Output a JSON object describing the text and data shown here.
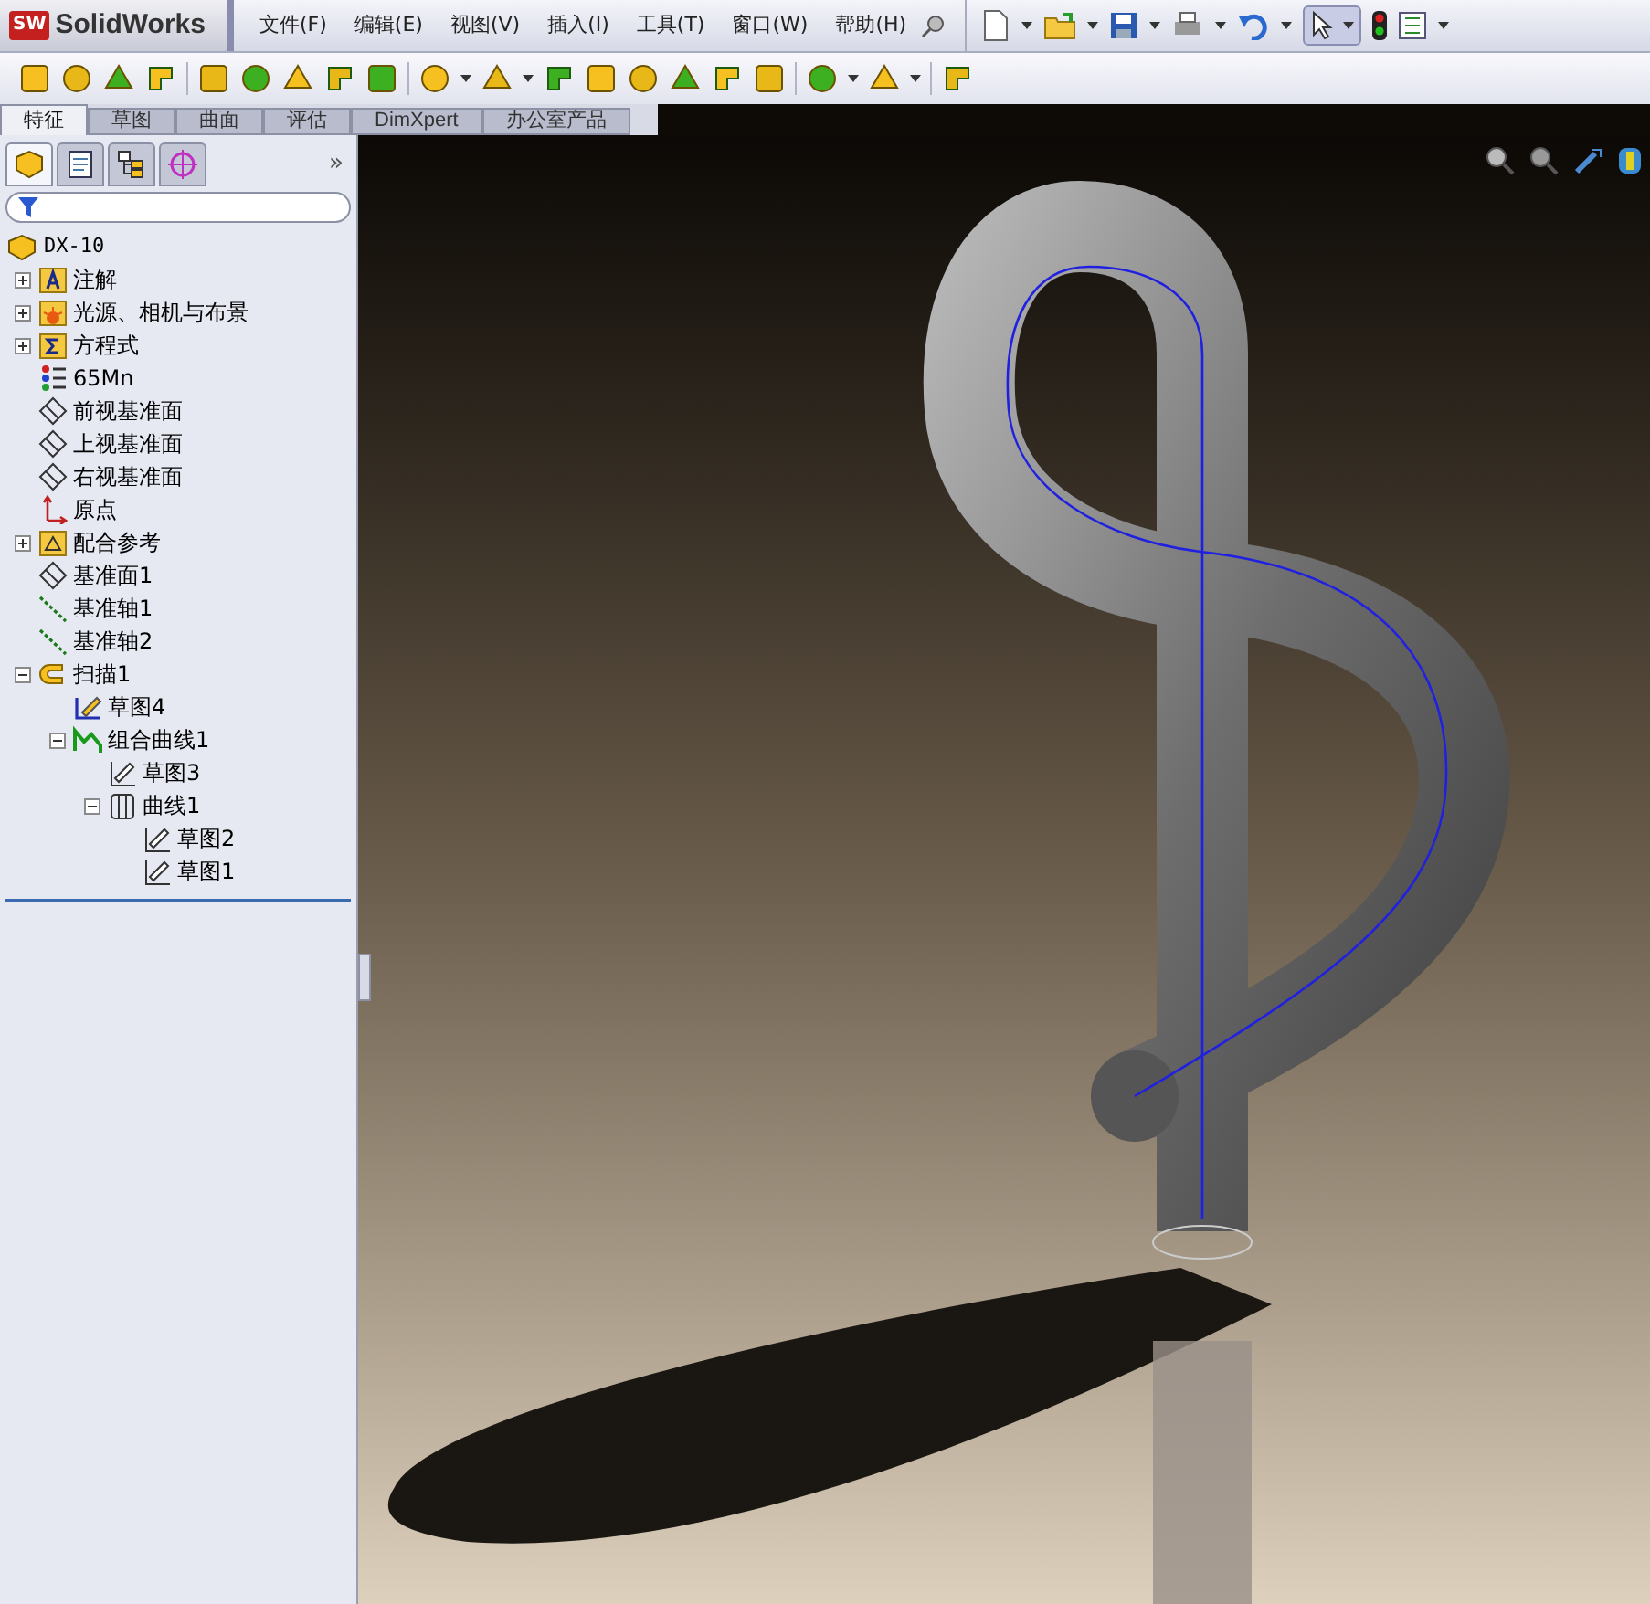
{
  "app": {
    "logo_badge": "SW",
    "logo_text": "SolidWorks"
  },
  "menu": [
    "文件(F)",
    "编辑(E)",
    "视图(V)",
    "插入(I)",
    "工具(T)",
    "窗口(W)",
    "帮助(H)"
  ],
  "tabs": [
    {
      "label": "特征",
      "selected": true
    },
    {
      "label": "草图",
      "selected": false
    },
    {
      "label": "曲面",
      "selected": false
    },
    {
      "label": "评估",
      "selected": false
    },
    {
      "label": "DimXpert",
      "selected": false
    },
    {
      "label": "办公室产品",
      "selected": false
    }
  ],
  "panel_tabs": [
    {
      "kind": "feature",
      "selected": true
    },
    {
      "kind": "property",
      "selected": false
    },
    {
      "kind": "config",
      "selected": false
    },
    {
      "kind": "target",
      "selected": false
    }
  ],
  "panel_more": "»",
  "tree": {
    "root": "DX-10",
    "items": [
      {
        "label": "注解",
        "kind": "annotation",
        "expanded": false
      },
      {
        "label": "光源、相机与布景",
        "kind": "lights",
        "expanded": false
      },
      {
        "label": "方程式",
        "kind": "equation",
        "expanded": false
      },
      {
        "label": "65Mn",
        "kind": "material"
      },
      {
        "label": "前视基准面",
        "kind": "plane"
      },
      {
        "label": "上视基准面",
        "kind": "plane"
      },
      {
        "label": "右视基准面",
        "kind": "plane"
      },
      {
        "label": "原点",
        "kind": "origin"
      },
      {
        "label": "配合参考",
        "kind": "mates",
        "expanded": false
      },
      {
        "label": "基准面1",
        "kind": "plane"
      },
      {
        "label": "基准轴1",
        "kind": "axis"
      },
      {
        "label": "基准轴2",
        "kind": "axis"
      },
      {
        "label": "扫描1",
        "kind": "sweep",
        "expanded": true,
        "children": [
          {
            "label": "草图4",
            "kind": "sketch"
          },
          {
            "label": "组合曲线1",
            "kind": "composite",
            "expanded": true,
            "children": [
              {
                "label": "草图3",
                "kind": "sketch2"
              },
              {
                "label": "曲线1",
                "kind": "curve",
                "expanded": true,
                "children": [
                  {
                    "label": "草图2",
                    "kind": "sketch2"
                  },
                  {
                    "label": "草图1",
                    "kind": "sketch2"
                  }
                ]
              }
            ]
          }
        ]
      }
    ]
  }
}
